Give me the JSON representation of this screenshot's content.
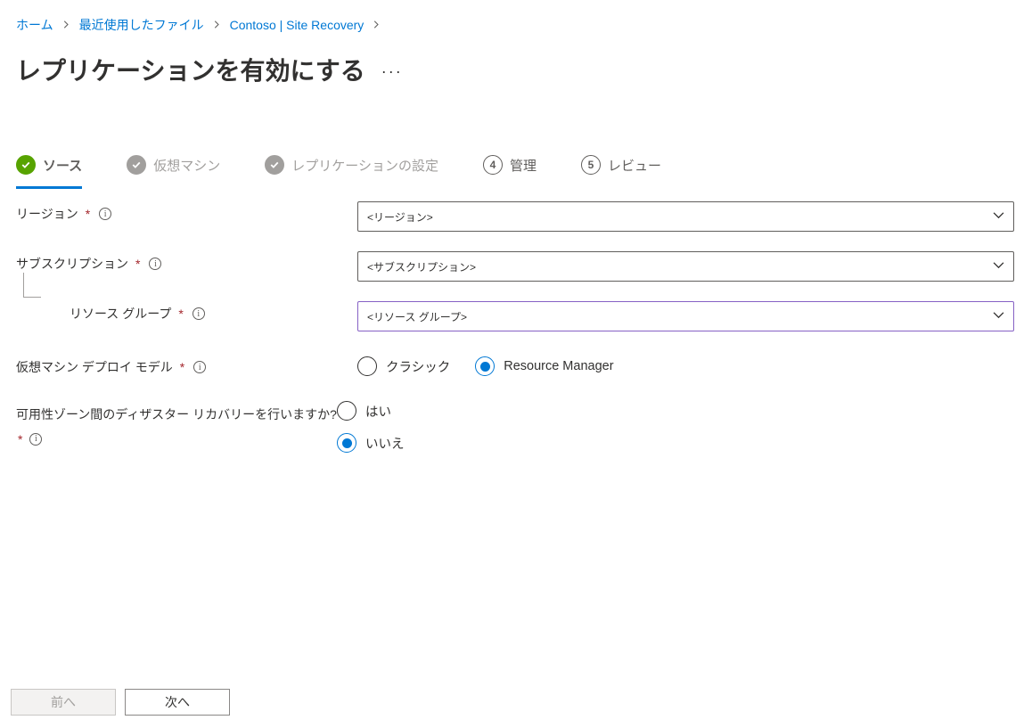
{
  "breadcrumb": {
    "home": "ホーム",
    "recent": "最近使用したファイル",
    "item": "Contoso  | Site Recovery"
  },
  "title": "レプリケーションを有効にする",
  "steps": {
    "source": "ソース",
    "vms": "仮想マシン",
    "replication": "レプリケーションの設定",
    "manage": "管理",
    "review": "レビュー",
    "num4": "4",
    "num5": "5"
  },
  "form": {
    "region_label": "リージョン",
    "region_placeholder": "<リージョン>",
    "subscription_label": "サブスクリプション",
    "subscription_placeholder": "<サブスクリプション>",
    "resource_group_label": "リソース グループ",
    "resource_group_placeholder": "<リソース グループ>",
    "deploy_model_label": "仮想マシン デプロイ モデル",
    "deploy_model_options": {
      "classic": "クラシック",
      "rm": "Resource Manager"
    },
    "az_dr_label": "可用性ゾーン間のディザスター リカバリーを行いますか?",
    "az_dr_options": {
      "yes": "はい",
      "no": "いいえ"
    }
  },
  "footer": {
    "prev": "前へ",
    "next": "次へ"
  }
}
